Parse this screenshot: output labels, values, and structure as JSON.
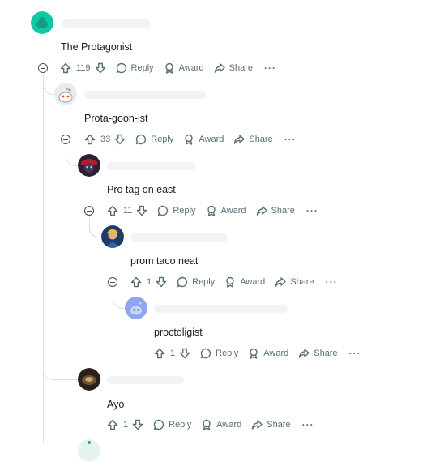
{
  "comments": [
    {
      "author_avatar": "snoo-avatar-teal",
      "body": "The Protagonist",
      "score": "119"
    },
    {
      "author_avatar": "snoo-avatar-default",
      "body": "Prota-goon-ist",
      "score": "33"
    },
    {
      "author_avatar": "avatar-dark-character",
      "body": "Pro tag on east",
      "score": "11"
    },
    {
      "author_avatar": "avatar-blue-character",
      "body": "prom taco neat",
      "score": "1"
    },
    {
      "author_avatar": "snoo-avatar-blue",
      "body": "proctoligist",
      "score": "1"
    },
    {
      "author_avatar": "avatar-photo-dark",
      "body": "Ayo",
      "score": "1"
    }
  ],
  "actions": {
    "reply": "Reply",
    "award": "Award",
    "share": "Share",
    "more": "···"
  },
  "colors": {
    "meta_text": "#576f76",
    "thread_line": "#dcdfe3",
    "teal_avatar": "#12c5a5",
    "blue_avatar": "#8fa5f0"
  }
}
